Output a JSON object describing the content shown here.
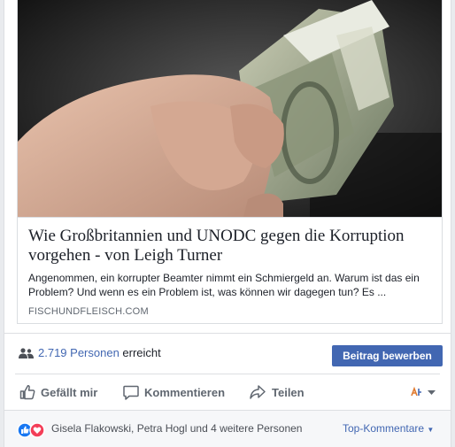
{
  "post": {
    "link": {
      "headline": "Wie Großbritannien und UNODC gegen die Korruption vorgehen - von Leigh Turner",
      "description": "Angenommen, ein korrupter Beamter nimmt ein Schmiergeld an. Warum ist das ein Problem? Und wenn es ein Problem ist, was können wir dagegen tun? Es ...",
      "domain": "FISCHUNDFLEISCH.COM",
      "image_alt": "Hand holding rolled-up euro banknotes"
    },
    "reach": {
      "icon": "people-icon",
      "count": "2.719 Personen",
      "suffix": "erreicht",
      "boost_label": "Beitrag bewerben"
    },
    "actions": {
      "like": "Gefällt mir",
      "comment": "Kommentieren",
      "share": "Teilen"
    },
    "comments": {
      "reactors": "Gisela Flakowski, Petra Hogl und 4 weitere Personen",
      "sort_label": "Top-Kommentare",
      "reaction_icons": [
        "like-icon",
        "love-icon"
      ]
    },
    "colors": {
      "accent": "#4267b2",
      "like_blue": "#1877f2",
      "love_red": "#f33e58"
    }
  }
}
